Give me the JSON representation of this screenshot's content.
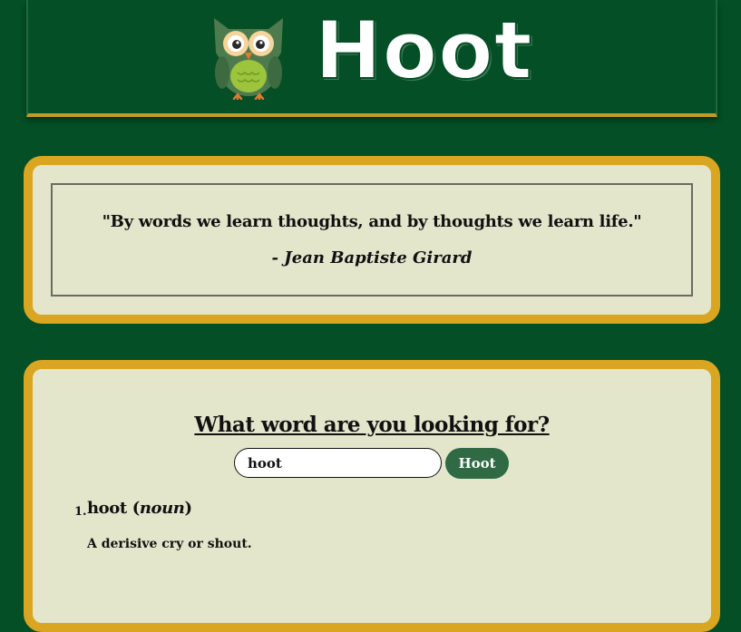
{
  "header": {
    "logo_text": "Hoot",
    "logo_icon": "owl-icon"
  },
  "quote": {
    "text": "\"By words we learn thoughts, and by thoughts we learn life.\"",
    "author": "- Jean Baptiste Girard"
  },
  "search": {
    "heading": "What word are you looking for?",
    "input_value": "hoot",
    "button_label": "Hoot"
  },
  "results": [
    {
      "number": "1.",
      "word": "hoot",
      "part_of_speech": "noun",
      "definition": "A derisive cry or shout."
    }
  ],
  "colors": {
    "background": "#044f25",
    "card": "#e3e6cb",
    "card_border": "#daa520",
    "button": "#2f6a44"
  }
}
